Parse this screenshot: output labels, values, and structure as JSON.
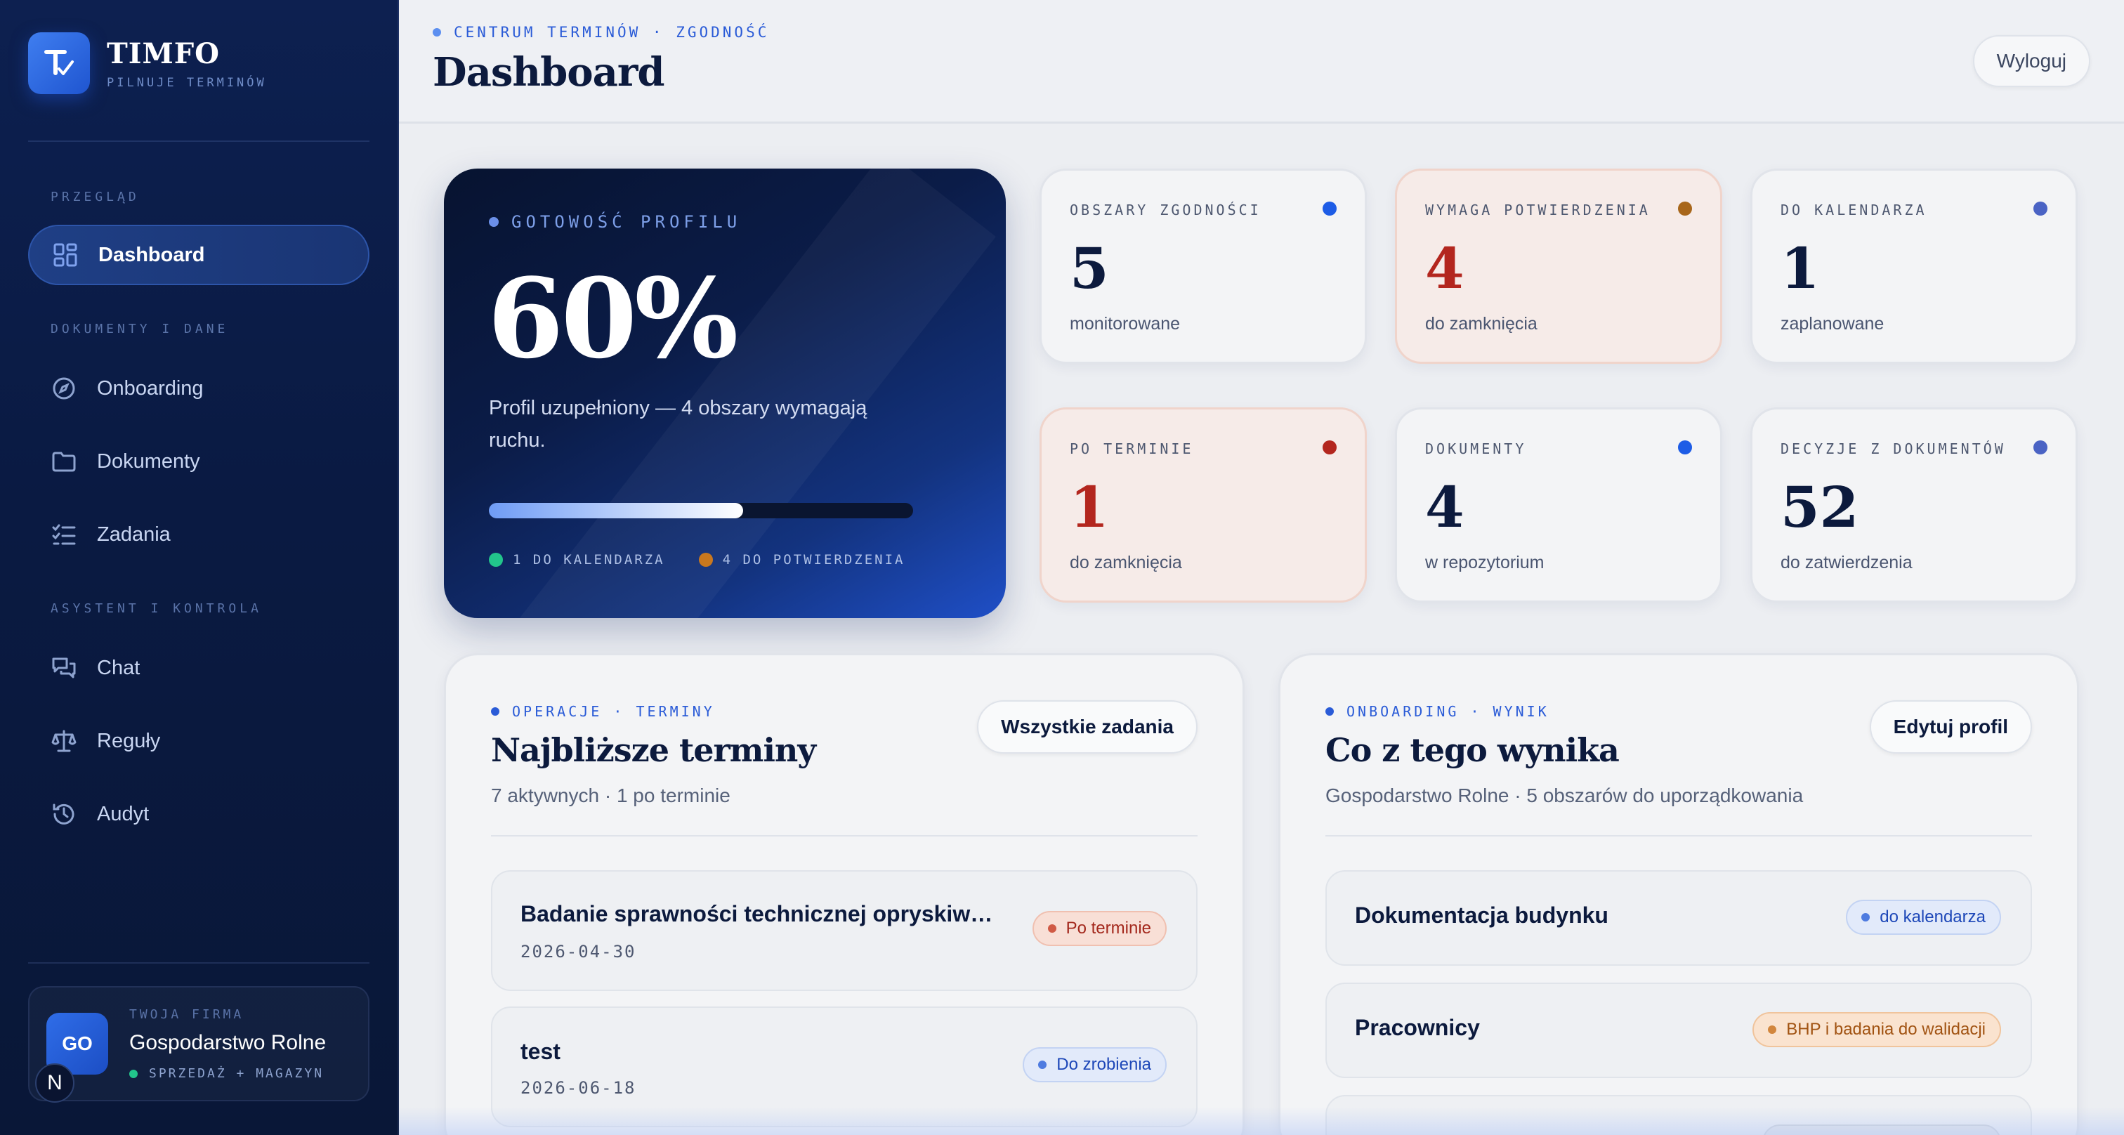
{
  "app": {
    "name": "TIMFO",
    "tagline": "PILNUJE TERMINÓW",
    "logo_letter": "T"
  },
  "sidebar": {
    "sections": [
      {
        "label": "PRZEGLĄD"
      },
      {
        "label": "DOKUMENTY I DANE"
      },
      {
        "label": "ASYSTENT I KONTROLA"
      }
    ],
    "items": [
      {
        "label": "Dashboard",
        "icon": "grid-icon",
        "active": true
      },
      {
        "label": "Onboarding",
        "icon": "compass-icon"
      },
      {
        "label": "Dokumenty",
        "icon": "folder-icon"
      },
      {
        "label": "Zadania",
        "icon": "checklist-icon"
      },
      {
        "label": "Chat",
        "icon": "chat-icon"
      },
      {
        "label": "Reguły",
        "icon": "scale-icon"
      },
      {
        "label": "Audyt",
        "icon": "history-icon"
      }
    ],
    "company": {
      "label": "TWOJA FIRMA",
      "name": "Gospodarstwo Rolne",
      "avatar": "GO",
      "dept": "SPRZEDAŻ + MAGAZYN",
      "badge": "N"
    }
  },
  "header": {
    "breadcrumb": "CENTRUM TERMINÓW · ZGODNOŚĆ",
    "title": "Dashboard",
    "logout_label": "Wyloguj"
  },
  "hero": {
    "kicker": "GOTOWOŚĆ PROFILU",
    "value": "60%",
    "progress": 0.6,
    "description": "Profil uzupełniony — 4 obszary wymagają ruchu.",
    "legend": [
      {
        "label": "1 DO KALENDARZA",
        "color": "#22c58b"
      },
      {
        "label": "4 DO POTWIERDZENIA",
        "color": "#c9781e"
      }
    ]
  },
  "stats": [
    {
      "label": "OBSZARY ZGODNOŚCI",
      "value": "5",
      "sub": "monitorowane",
      "dot": "#1d5ce6",
      "value_color": "#0c1a3d",
      "warn": false
    },
    {
      "label": "WYMAGA POTWIERDZENIA",
      "value": "4",
      "sub": "do zamknięcia",
      "dot": "#a8661a",
      "value_color": "#b3261e",
      "warn": true
    },
    {
      "label": "DO KALENDARZA",
      "value": "1",
      "sub": "zaplanowane",
      "dot": "#4a63c4",
      "value_color": "#0c1a3d",
      "warn": false
    },
    {
      "label": "PO TERMINIE",
      "value": "1",
      "sub": "do zamknięcia",
      "dot": "#b3261e",
      "value_color": "#b3261e",
      "warn": true
    },
    {
      "label": "DOKUMENTY",
      "value": "4",
      "sub": "w repozytorium",
      "dot": "#1d5ce6",
      "value_color": "#0c1a3d",
      "warn": false
    },
    {
      "label": "DECYZJE Z DOKUMENTÓW",
      "value": "52",
      "sub": "do zatwierdzenia",
      "dot": "#4a63c4",
      "value_color": "#0c1a3d",
      "warn": false
    }
  ],
  "deadlines": {
    "kicker": "OPERACJE · TERMINY",
    "title": "Najbliższe terminy",
    "subtitle": "7 aktywnych · 1 po terminie",
    "button": "Wszystkie zadania",
    "rows": [
      {
        "title": "Badanie sprawności technicznej opryskiw…",
        "date": "2026-04-30",
        "status": "Po terminie",
        "tone": "red"
      },
      {
        "title": "test",
        "date": "2026-06-18",
        "status": "Do zrobienia",
        "tone": "blue"
      }
    ]
  },
  "onboarding": {
    "kicker": "ONBOARDING · WYNIK",
    "title": "Co z tego wynika",
    "subtitle": "Gospodarstwo Rolne · 5 obszarów do uporządkowania",
    "button": "Edytuj profil",
    "rows": [
      {
        "title": "Dokumentacja budynku",
        "status": "do kalendarza",
        "tone": "blue"
      },
      {
        "title": "Pracownicy",
        "status": "BHP i badania do walidacji",
        "tone": "amber"
      }
    ]
  }
}
